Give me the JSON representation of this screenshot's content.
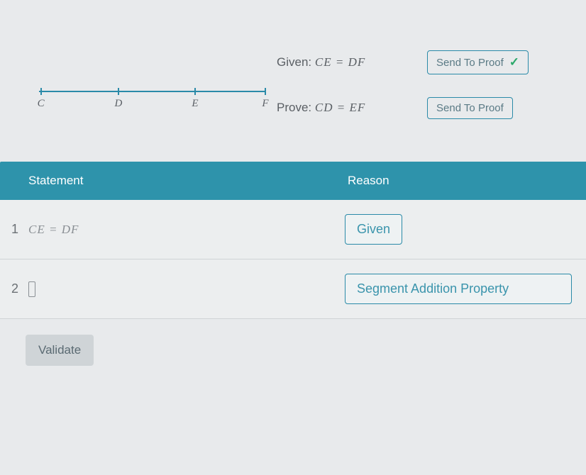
{
  "diagram": {
    "points": [
      "C",
      "D",
      "E",
      "F"
    ]
  },
  "given": {
    "label": "Given:",
    "expr": "CE = DF"
  },
  "prove": {
    "label": "Prove:",
    "expr": "CD = EF"
  },
  "buttons": {
    "send1": "Send To Proof",
    "send2": "Send To Proof",
    "validate": "Validate"
  },
  "table": {
    "header_statement": "Statement",
    "header_reason": "Reason",
    "rows": [
      {
        "num": "1",
        "statement": "CE = DF",
        "reason": "Given"
      },
      {
        "num": "2",
        "statement": "",
        "reason": "Segment Addition Property"
      }
    ]
  }
}
